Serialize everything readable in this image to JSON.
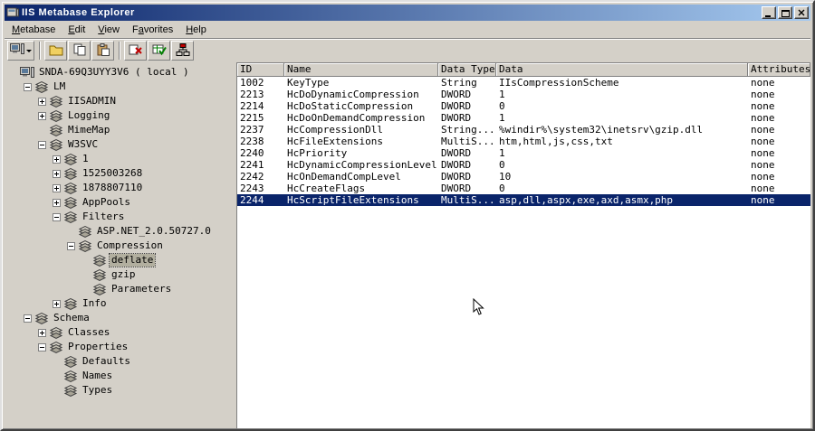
{
  "window": {
    "title": "IIS Metabase Explorer"
  },
  "colors": {
    "titlebar_start": "#0a246a",
    "titlebar_end": "#a6caf0",
    "selection": "#0a246a",
    "tree_selection": "#b2af9f",
    "window_bg": "#d4d0c8"
  },
  "menu": {
    "items": [
      {
        "label": "Metabase",
        "accel_index": 0
      },
      {
        "label": "Edit",
        "accel_index": 0
      },
      {
        "label": "View",
        "accel_index": 0
      },
      {
        "label": "Favorites",
        "accel_index": 1
      },
      {
        "label": "Help",
        "accel_index": 0
      }
    ]
  },
  "toolbar": {
    "buttons": [
      {
        "name": "connect",
        "icon": "computer",
        "dropdown": true
      },
      {
        "type": "separator"
      },
      {
        "name": "open",
        "icon": "folder"
      },
      {
        "name": "copy",
        "icon": "copy"
      },
      {
        "name": "paste",
        "icon": "paste"
      },
      {
        "type": "separator"
      },
      {
        "name": "delete",
        "icon": "delete"
      },
      {
        "name": "export",
        "icon": "grid-check"
      },
      {
        "name": "network",
        "icon": "network"
      }
    ]
  },
  "tree": {
    "items": [
      {
        "label": "SNDA-69Q3UYY3V6 ( local )",
        "depth": 0,
        "expand": "none",
        "icon": "computer",
        "selected": false
      },
      {
        "label": "LM",
        "depth": 1,
        "expand": "minus",
        "icon": "node",
        "selected": false
      },
      {
        "label": "IISADMIN",
        "depth": 2,
        "expand": "plus",
        "icon": "node",
        "selected": false
      },
      {
        "label": "Logging",
        "depth": 2,
        "expand": "plus",
        "icon": "node",
        "selected": false
      },
      {
        "label": "MimeMap",
        "depth": 2,
        "expand": "none",
        "icon": "node",
        "selected": false
      },
      {
        "label": "W3SVC",
        "depth": 2,
        "expand": "minus",
        "icon": "node",
        "selected": false
      },
      {
        "label": "1",
        "depth": 3,
        "expand": "plus",
        "icon": "node",
        "selected": false
      },
      {
        "label": "1525003268",
        "depth": 3,
        "expand": "plus",
        "icon": "node",
        "selected": false
      },
      {
        "label": "1878807110",
        "depth": 3,
        "expand": "plus",
        "icon": "node",
        "selected": false
      },
      {
        "label": "AppPools",
        "depth": 3,
        "expand": "plus",
        "icon": "node",
        "selected": false
      },
      {
        "label": "Filters",
        "depth": 3,
        "expand": "minus",
        "icon": "node",
        "selected": false
      },
      {
        "label": "ASP.NET_2.0.50727.0",
        "depth": 4,
        "expand": "none",
        "icon": "node",
        "selected": false
      },
      {
        "label": "Compression",
        "depth": 4,
        "expand": "minus",
        "icon": "node",
        "selected": false
      },
      {
        "label": "deflate",
        "depth": 5,
        "expand": "none",
        "icon": "node",
        "selected": true
      },
      {
        "label": "gzip",
        "depth": 5,
        "expand": "none",
        "icon": "node",
        "selected": false
      },
      {
        "label": "Parameters",
        "depth": 5,
        "expand": "none",
        "icon": "node",
        "selected": false
      },
      {
        "label": "Info",
        "depth": 3,
        "expand": "plus",
        "icon": "node",
        "selected": false
      },
      {
        "label": "Schema",
        "depth": 1,
        "expand": "minus",
        "icon": "node",
        "selected": false
      },
      {
        "label": "Classes",
        "depth": 2,
        "expand": "plus",
        "icon": "node",
        "selected": false
      },
      {
        "label": "Properties",
        "depth": 2,
        "expand": "minus",
        "icon": "node",
        "selected": false
      },
      {
        "label": "Defaults",
        "depth": 3,
        "expand": "none",
        "icon": "node",
        "selected": false
      },
      {
        "label": "Names",
        "depth": 3,
        "expand": "none",
        "icon": "node",
        "selected": false
      },
      {
        "label": "Types",
        "depth": 3,
        "expand": "none",
        "icon": "node",
        "selected": false
      }
    ]
  },
  "table": {
    "columns": [
      "ID",
      "Name",
      "Data Type",
      "Data",
      "Attributes"
    ],
    "rows": [
      {
        "id": "1002",
        "name": "KeyType",
        "type": "String",
        "data": "IIsCompressionScheme",
        "attributes": "none",
        "selected": false
      },
      {
        "id": "2213",
        "name": "HcDoDynamicCompression",
        "type": "DWORD",
        "data": "1",
        "attributes": "none",
        "selected": false
      },
      {
        "id": "2214",
        "name": "HcDoStaticCompression",
        "type": "DWORD",
        "data": "0",
        "attributes": "none",
        "selected": false
      },
      {
        "id": "2215",
        "name": "HcDoOnDemandCompression",
        "type": "DWORD",
        "data": "1",
        "attributes": "none",
        "selected": false
      },
      {
        "id": "2237",
        "name": "HcCompressionDll",
        "type": "String...",
        "data": "%windir%\\system32\\inetsrv\\gzip.dll",
        "attributes": "none",
        "selected": false
      },
      {
        "id": "2238",
        "name": "HcFileExtensions",
        "type": "MultiS...",
        "data": "htm,html,js,css,txt",
        "attributes": "none",
        "selected": false
      },
      {
        "id": "2240",
        "name": "HcPriority",
        "type": "DWORD",
        "data": "1",
        "attributes": "none",
        "selected": false
      },
      {
        "id": "2241",
        "name": "HcDynamicCompressionLevel",
        "type": "DWORD",
        "data": "0",
        "attributes": "none",
        "selected": false
      },
      {
        "id": "2242",
        "name": "HcOnDemandCompLevel",
        "type": "DWORD",
        "data": "10",
        "attributes": "none",
        "selected": false
      },
      {
        "id": "2243",
        "name": "HcCreateFlags",
        "type": "DWORD",
        "data": "0",
        "attributes": "none",
        "selected": false
      },
      {
        "id": "2244",
        "name": "HcScriptFileExtensions",
        "type": "MultiS...",
        "data": "asp,dll,aspx,exe,axd,asmx,php",
        "attributes": "none",
        "selected": true
      }
    ]
  }
}
